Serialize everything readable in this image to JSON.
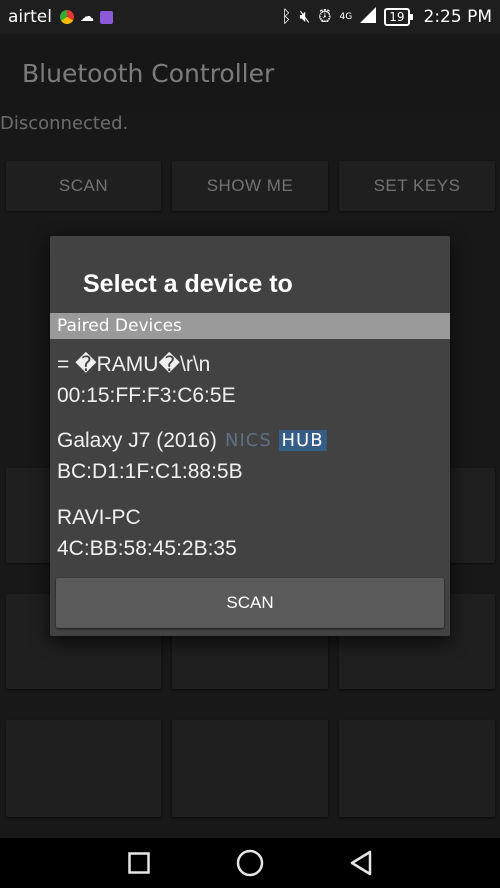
{
  "status_bar": {
    "carrier": "airtel",
    "battery": "19",
    "time": "2:25 PM",
    "network": "4G"
  },
  "app": {
    "title": "Bluetooth Controller",
    "connection_status": "Disconnected."
  },
  "buttons": {
    "scan": "SCAN",
    "show_me": "SHOW ME",
    "set_keys": "SET KEYS"
  },
  "dialog": {
    "title": "Select a device to",
    "section": "Paired Devices",
    "devices": [
      {
        "name": "= �RAMU�\\r\\n",
        "address": "00:15:FF:F3:C6:5E"
      },
      {
        "name": "Galaxy J7 (2016)",
        "address": "BC:D1:1F:C1:88:5B"
      },
      {
        "name": "RAVI-PC",
        "address": "4C:BB:58:45:2B:35"
      }
    ],
    "scan_button": "SCAN"
  },
  "watermark": {
    "text": "NICS",
    "hub": "HUB"
  }
}
